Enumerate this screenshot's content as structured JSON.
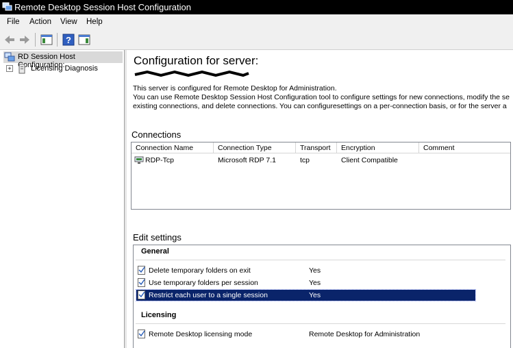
{
  "window": {
    "title": "Remote Desktop Session Host Configuration"
  },
  "menu": {
    "items": [
      "File",
      "Action",
      "View",
      "Help"
    ]
  },
  "tree": {
    "root_label": "RD Session Host Configuration:",
    "child_label": "Licensing Diagnosis"
  },
  "main": {
    "heading": "Configuration for server:",
    "desc_lines": [
      "This server is configured for Remote Desktop for Administration.",
      "You can use Remote Desktop Session Host Configuration tool to configure settings for new connections, modify the se",
      "existing connections, and delete connections. You can configuresettings on a per-connection basis, or for the server a"
    ]
  },
  "connections": {
    "title": "Connections",
    "columns": [
      "Connection Name",
      "Connection Type",
      "Transport",
      "Encryption",
      "Comment"
    ],
    "rows": [
      [
        "RDP-Tcp",
        "Microsoft RDP 7.1",
        "tcp",
        "Client Compatible",
        ""
      ]
    ]
  },
  "edit_settings": {
    "title": "Edit settings",
    "groups": [
      {
        "name": "General",
        "items": [
          {
            "name": "Delete temporary folders on exit",
            "value": "Yes"
          },
          {
            "name": "Use temporary folders per session",
            "value": "Yes"
          },
          {
            "name": "Restrict each user to a single session",
            "value": "Yes"
          }
        ]
      },
      {
        "name": "Licensing",
        "items": [
          {
            "name": "Remote Desktop licensing mode",
            "value": "Remote Desktop for Administration"
          }
        ]
      }
    ]
  },
  "colors": {
    "selection": "#0a246a",
    "titlebar": "#000000",
    "tree_selected": "#d9d9d9"
  }
}
